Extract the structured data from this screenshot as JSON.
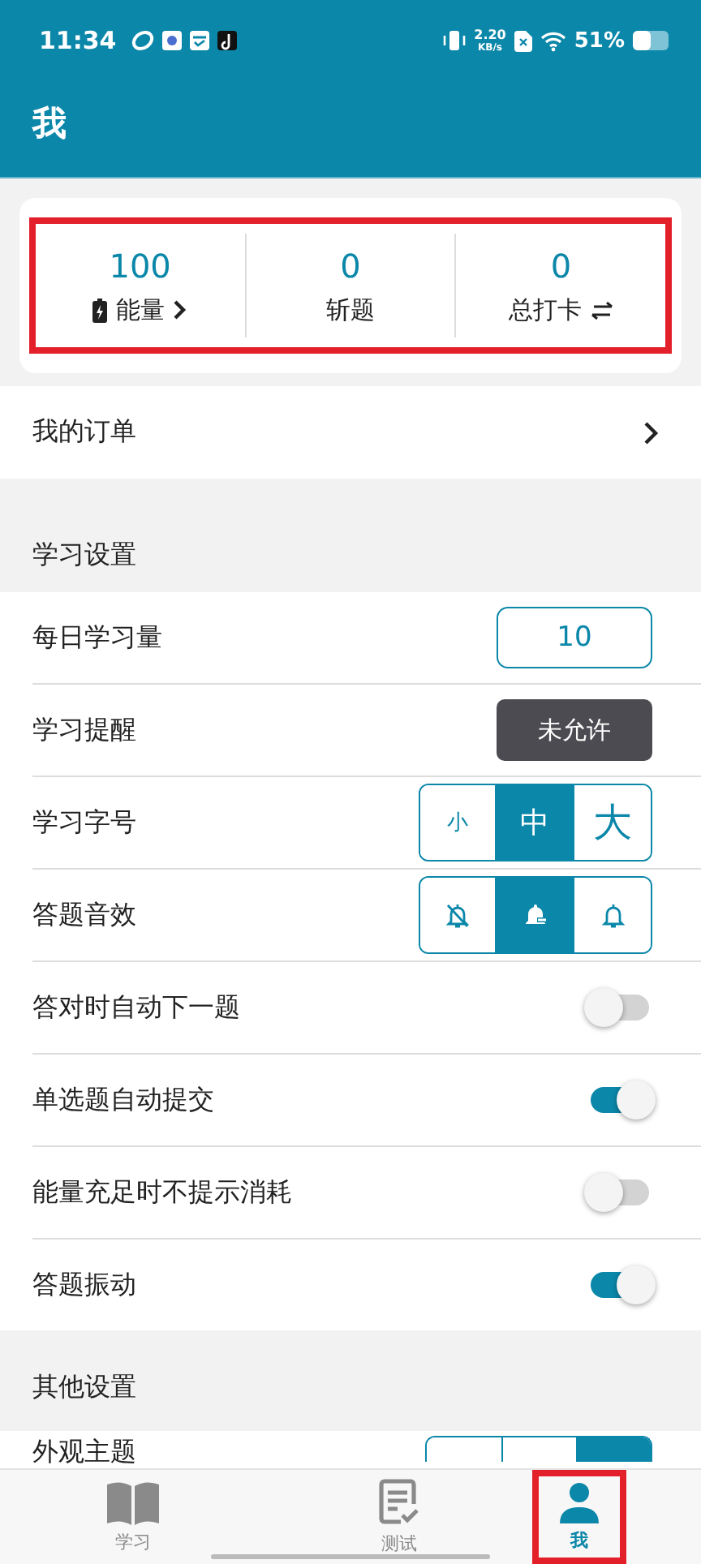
{
  "status_bar": {
    "time": "11:34",
    "speed": "2.20",
    "speed_unit": "KB/s",
    "battery": "51%"
  },
  "header": {
    "title": "我"
  },
  "stats": [
    {
      "value": "100",
      "label": "能量",
      "kind": "energy"
    },
    {
      "value": "0",
      "label": "斩题",
      "kind": "plain"
    },
    {
      "value": "0",
      "label": "总打卡",
      "kind": "swap"
    }
  ],
  "orders": {
    "label": "我的订单"
  },
  "sections": [
    {
      "title": "学习设置",
      "rows": [
        {
          "label": "每日学习量",
          "kind": "number",
          "value": "10"
        },
        {
          "label": "学习提醒",
          "kind": "permission",
          "value": "未允许"
        },
        {
          "label": "学习字号",
          "kind": "segments",
          "options": [
            {
              "label": "小",
              "selected": false
            },
            {
              "label": "中",
              "selected": true
            },
            {
              "label": "大",
              "selected": false
            }
          ]
        },
        {
          "label": "答题音效",
          "kind": "sound",
          "options": [
            {
              "selected": false
            },
            {
              "selected": true
            },
            {
              "selected": false
            }
          ]
        },
        {
          "label": "答对时自动下一题",
          "kind": "switch",
          "on": false
        },
        {
          "label": "单选题自动提交",
          "kind": "switch",
          "on": true
        },
        {
          "label": "能量充足时不提示消耗",
          "kind": "switch",
          "on": false
        },
        {
          "label": "答题振动",
          "kind": "switch",
          "on": true
        }
      ]
    },
    {
      "title": "其他设置",
      "rows": [
        {
          "label": "外观主题",
          "kind": "theme",
          "options": [
            {
              "selected": false
            },
            {
              "selected": false
            },
            {
              "selected": true
            }
          ]
        }
      ]
    }
  ],
  "stats_highlighted": true,
  "tabs": [
    {
      "label": "学习",
      "selected": false,
      "highlighted": false
    },
    {
      "label": "测试",
      "selected": false,
      "highlighted": false
    },
    {
      "label": "我",
      "selected": true,
      "highlighted": true
    }
  ]
}
